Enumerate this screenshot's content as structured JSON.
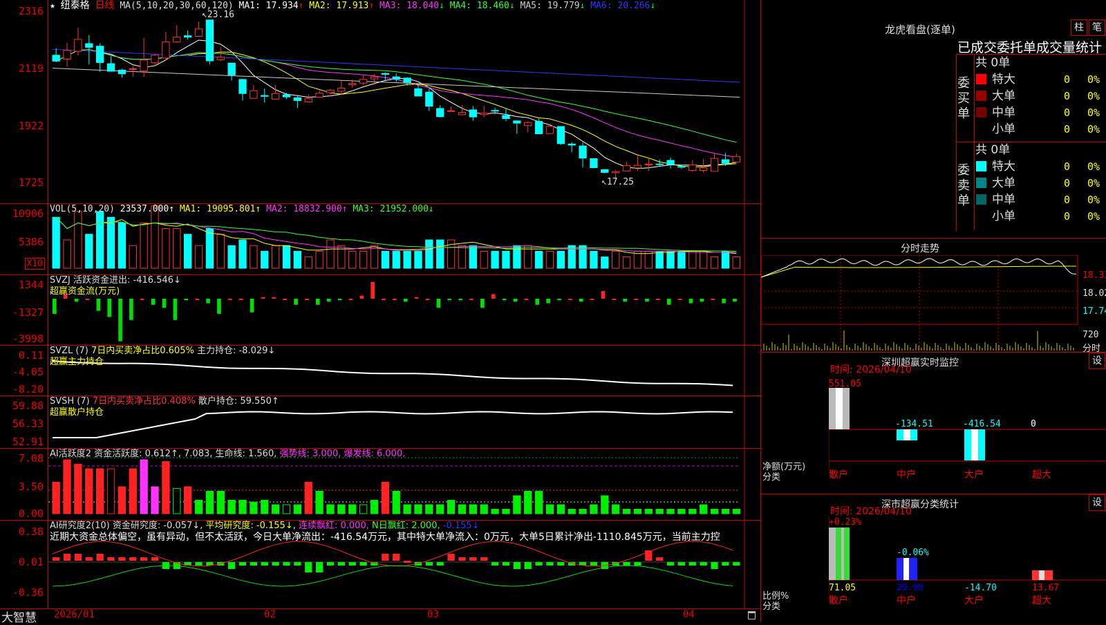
{
  "stock": {
    "star": "★",
    "name": "纽泰格",
    "period": "日线"
  },
  "price_panel": {
    "ma_header": "MA(5,10,20,30,60,120)",
    "ma": [
      {
        "label": "MA1: 17.934",
        "arrow": "↑",
        "color": "#ffffff"
      },
      {
        "label": "MA2: 17.913",
        "arrow": "↑",
        "color": "#ffff00"
      },
      {
        "label": "MA3: 18.040",
        "arrow": "↓",
        "color": "#ff33ff"
      },
      {
        "label": "MA4: 18.460",
        "arrow": "↓",
        "color": "#33ff33"
      },
      {
        "label": "MA5: 19.779",
        "arrow": "↓",
        "color": "#cccccc"
      },
      {
        "label": "MA6: 20.266",
        "arrow": "↓",
        "color": "#3333ff"
      }
    ],
    "axis": [
      "2316",
      "2119",
      "1922",
      "1725"
    ],
    "high_mark": "23.16",
    "low_mark": "17.25"
  },
  "vol_panel": {
    "header": "VOL(5,10,20)",
    "value": "23537.000↑",
    "ma1": "MA1: 19095.801↑",
    "ma2": "MA2: 18832.900↑",
    "ma3": "MA3: 21952.000↓",
    "axis": [
      "10906",
      "5386"
    ],
    "unit": "X10"
  },
  "svzj_panel": {
    "header": "SVZJ 活跃资金进出: -416.546↓",
    "title": "超赢资金流(万元)",
    "axis": [
      "1344",
      "-1327",
      "-3998"
    ]
  },
  "svzl_panel": {
    "header_a": "SVZL (7)",
    "header_b": "7日内买卖净占比0.605%",
    "header_c": "主力持仓: -8.029↓",
    "title": "超赢主力持仓",
    "axis": [
      "0.11",
      "-4.05",
      "-8.20"
    ]
  },
  "svsh_panel": {
    "header_a": "SVSH (7)",
    "header_b": "7日内买卖净占比0.408%",
    "header_c": "散户持仓: 59.550↑",
    "title": "超赢散户持仓",
    "axis": [
      "59.88",
      "56.33",
      "52.91"
    ]
  },
  "ai_active": {
    "header_a": "AI活跃度2 资金活跃度: 0.612↑, 7.083, 生命线: 1.560,",
    "header_b": "强势线: 3.000, 爆发线: 6.000,",
    "axis": [
      "7.08",
      "3.50",
      "0.00"
    ]
  },
  "ai_research": {
    "header_a": "AI研究度2(10) 资金研究度: -0.057↓,",
    "header_b": "平均研究度: -0.155↓,",
    "header_c": "连续飘红: 0.000,",
    "header_d": "N日飘红: 2.000,",
    "header_e": "-0.155↓",
    "comment": "近期大资金总体偏空，虽有异动，但不太活跃，今日大单净流出：-416.54万元，其中特大单净流入：0万元，大单5日累计净出-1110.845万元，当前主力控",
    "axis": [
      "0.38",
      "0.01",
      "-0.36"
    ]
  },
  "bottom": {
    "brand": "大智慧",
    "dates": [
      "2026/01",
      "02",
      "03",
      "04"
    ]
  },
  "dragon": {
    "title": "龙虎看盘(逐单)",
    "btn_zhu": "柱",
    "btn_pen": "笔",
    "subtitle": "已成交委托单成交量统计",
    "buy": {
      "label": "委买单",
      "total": "共 0单",
      "rows": [
        {
          "name": "特大",
          "val": "0",
          "pct": "0%",
          "color": "#ff0000"
        },
        {
          "name": "大单",
          "val": "0",
          "pct": "0%",
          "color": "#990000"
        },
        {
          "name": "中单",
          "val": "0",
          "pct": "0%",
          "color": "#770000"
        },
        {
          "name": "小单",
          "val": "0",
          "pct": "0%",
          "color": "#000000"
        }
      ]
    },
    "sell": {
      "label": "委卖单",
      "total": "共 0单",
      "rows": [
        {
          "name": "特大",
          "val": "0",
          "pct": "0%",
          "color": "#00ffff"
        },
        {
          "name": "大单",
          "val": "0",
          "pct": "0%",
          "color": "#008888"
        },
        {
          "name": "中单",
          "val": "0",
          "pct": "0%",
          "color": "#006666"
        },
        {
          "name": "小单",
          "val": "0",
          "pct": "0%",
          "color": "#000000"
        }
      ]
    }
  },
  "intraday": {
    "title": "分时走势",
    "axis": [
      "18.31",
      "18.02",
      "17.74"
    ],
    "vol_axis": "720",
    "vol_label": "分时"
  },
  "sz_monitor": {
    "title": "深圳超赢实时监控",
    "btn": "设",
    "time": "时间: 2026/04/10",
    "axis": [
      "551.05",
      "228.52",
      "0",
      "-94.01",
      "-416.54"
    ],
    "unit_a": "净额(万元)",
    "unit_b": "分类",
    "cats": [
      "散户",
      "中户",
      "大户",
      "超大"
    ],
    "values": [
      "551.05",
      "-134.51",
      "-416.54",
      "0"
    ]
  },
  "sz_stats": {
    "title": "深市超赢分类统计",
    "btn": "设",
    "time": "时间: 2026/04/10",
    "axis": [
      "75",
      "50",
      "25",
      "0"
    ],
    "unit_a": "比例%",
    "unit_b": "分类",
    "cats": [
      "散户",
      "中户",
      "大户",
      "超大"
    ],
    "top_labels": [
      "+0.23%",
      "-0.06%"
    ],
    "values": [
      "71.05",
      "29.98",
      "-14.70",
      "13.67"
    ]
  },
  "chart_data": {
    "type": "candlestick",
    "candles": [
      [
        21.91,
        21.7,
        22.15,
        21.66
      ],
      [
        21.77,
        22.08,
        22.35,
        21.5
      ],
      [
        22.05,
        22.47,
        22.89,
        21.9
      ],
      [
        22.32,
        22.19,
        22.62,
        21.58
      ],
      [
        22.23,
        21.65,
        22.33,
        21.32
      ],
      [
        21.61,
        21.34,
        21.87,
        21.34
      ],
      [
        21.38,
        21.25,
        21.43,
        21.11
      ],
      [
        21.43,
        21.43,
        21.53,
        21.15
      ],
      [
        21.35,
        21.74,
        22.52,
        21.14
      ],
      [
        21.64,
        21.91,
        21.95,
        21.53
      ],
      [
        21.81,
        22.38,
        22.74,
        21.74
      ],
      [
        22.38,
        22.55,
        22.98,
        22.35
      ],
      [
        22.6,
        22.55,
        22.79,
        22.47
      ],
      [
        22.58,
        22.84,
        23.1,
        22.7
      ],
      [
        23.16,
        21.71,
        23.16,
        21.58
      ],
      [
        21.75,
        21.84,
        22.2,
        21.7
      ],
      [
        21.63,
        21.21,
        21.64,
        21.01
      ],
      [
        21.05,
        20.55,
        21.07,
        20.3
      ],
      [
        20.38,
        20.65,
        20.85,
        20.45
      ],
      [
        20.48,
        20.45,
        20.73,
        20.22
      ],
      [
        20.35,
        20.55,
        20.85,
        20.43
      ],
      [
        20.51,
        20.43,
        20.57,
        20.35
      ],
      [
        20.4,
        20.3,
        20.47,
        20.03
      ],
      [
        20.25,
        20.37,
        20.52,
        20.27
      ],
      [
        20.42,
        20.56,
        20.66,
        20.45
      ],
      [
        20.58,
        20.67,
        20.72,
        20.45
      ],
      [
        20.63,
        20.74,
        21.01,
        20.51
      ],
      [
        20.86,
        20.91,
        21.05,
        20.76
      ],
      [
        20.92,
        21.05,
        21.19,
        20.86
      ],
      [
        21.07,
        21.14,
        21.24,
        20.86
      ],
      [
        21.26,
        21.23,
        21.3,
        21.03
      ],
      [
        21.14,
        21.06,
        21.26,
        20.96
      ],
      [
        21.1,
        20.95,
        21.13,
        20.83
      ],
      [
        20.72,
        20.46,
        20.91,
        20.46
      ],
      [
        20.6,
        20.1,
        20.74,
        19.93
      ],
      [
        20.02,
        19.73,
        20.13,
        19.7
      ],
      [
        19.93,
        19.94,
        20.1,
        19.91
      ],
      [
        19.8,
        19.88,
        20.15,
        19.82
      ],
      [
        19.97,
        19.72,
        20.11,
        19.58
      ],
      [
        19.8,
        19.85,
        20.12,
        19.7
      ],
      [
        19.95,
        19.93,
        20.05,
        19.81
      ],
      [
        19.77,
        19.66,
        20.02,
        19.57
      ],
      [
        19.58,
        19.5,
        19.6,
        19.12
      ],
      [
        19.41,
        19.52,
        19.57,
        19.17
      ],
      [
        19.56,
        19.12,
        19.66,
        19.1
      ],
      [
        19.13,
        19.39,
        19.48,
        19.17
      ],
      [
        19.38,
        18.77,
        19.38,
        18.73
      ],
      [
        18.76,
        18.72,
        18.83,
        18.46
      ],
      [
        18.69,
        18.26,
        18.82,
        17.92
      ],
      [
        18.24,
        17.92,
        18.25,
        17.92
      ],
      [
        17.85,
        17.75,
        17.77,
        17.72
      ],
      [
        17.74,
        17.78,
        17.84,
        17.5
      ],
      [
        17.8,
        17.99,
        18.13,
        17.86
      ],
      [
        17.91,
        18.0,
        18.34,
        17.81
      ],
      [
        18.02,
        18.05,
        18.27,
        17.81
      ],
      [
        18.05,
        18.03,
        18.21,
        17.95
      ],
      [
        18.18,
        18.03,
        18.28,
        17.89
      ],
      [
        17.96,
        17.94,
        18.02,
        17.88
      ],
      [
        17.82,
        18.02,
        18.19,
        17.77
      ],
      [
        17.82,
        17.91,
        18.22,
        17.75
      ],
      [
        17.79,
        18.25,
        18.4,
        17.8
      ],
      [
        18.2,
        18.07,
        18.45,
        17.98
      ],
      [
        18.12,
        18.32,
        18.42,
        18.1
      ]
    ],
    "ylim": [
      17.0,
      23.5
    ]
  }
}
